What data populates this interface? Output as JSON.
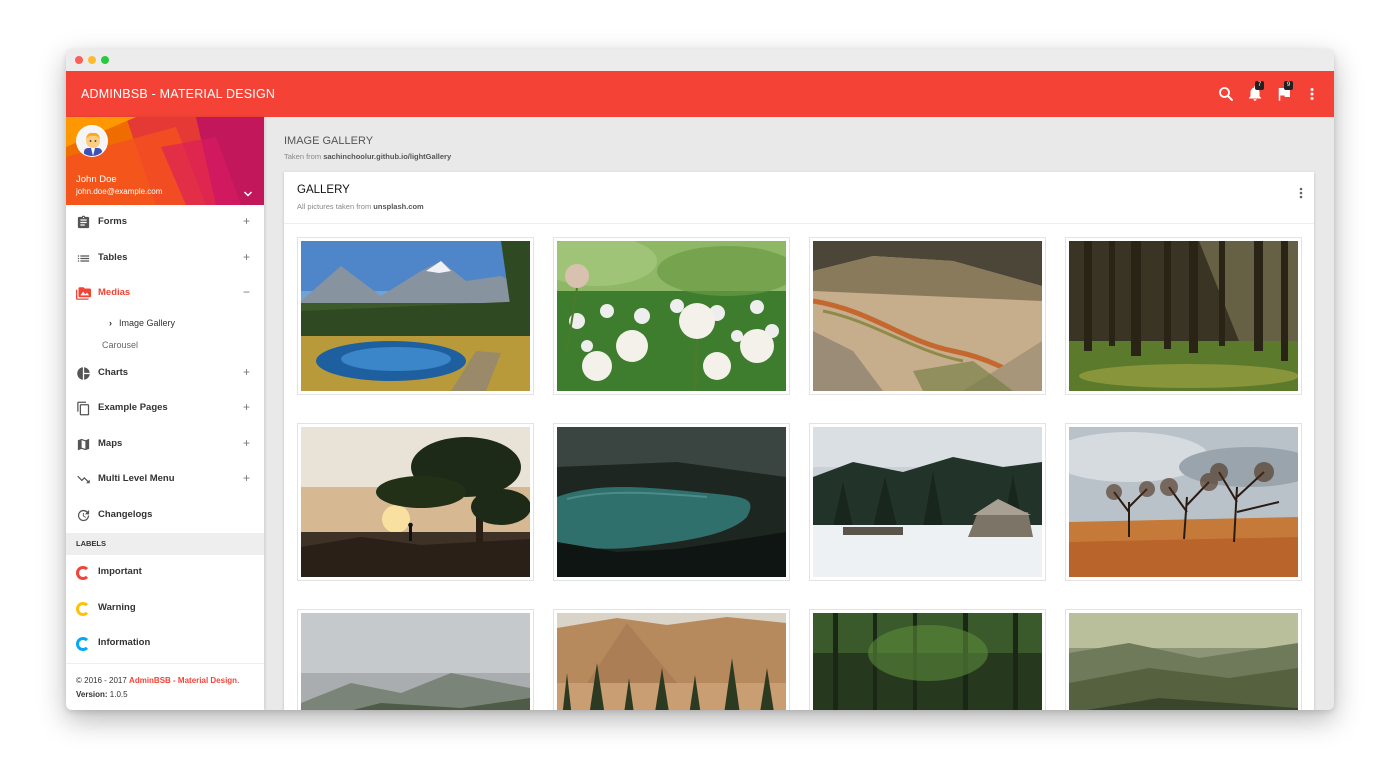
{
  "app": {
    "brand": "ADMINBSB - MATERIAL DESIGN",
    "accent": "#f44336"
  },
  "navbar": {
    "icons": [
      "search-icon",
      "notifications-icon",
      "flag-icon",
      "more-vertical-icon"
    ],
    "notifications_count": "7",
    "tasks_count": "9"
  },
  "user": {
    "name": "John Doe",
    "email": "john.doe@example.com"
  },
  "sidebar": {
    "items": [
      {
        "label": "Forms",
        "icon": "assignment-icon",
        "toggle": "+"
      },
      {
        "label": "Tables",
        "icon": "list-icon",
        "toggle": "+"
      },
      {
        "label": "Medias",
        "icon": "perm-media-icon",
        "toggle": "−"
      },
      {
        "label": "Charts",
        "icon": "pie-chart-icon",
        "toggle": "+"
      },
      {
        "label": "Example Pages",
        "icon": "content-copy-icon",
        "toggle": "+"
      },
      {
        "label": "Maps",
        "icon": "map-icon",
        "toggle": "+"
      },
      {
        "label": "Multi Level Menu",
        "icon": "trending-down-icon",
        "toggle": "+"
      },
      {
        "label": "Changelogs",
        "icon": "update-icon",
        "toggle": ""
      }
    ],
    "submenu": [
      {
        "label": "Image Gallery"
      },
      {
        "label": "Carousel"
      }
    ],
    "labels_header": "LABELS",
    "labels": [
      {
        "label": "Important",
        "color": "#f44336"
      },
      {
        "label": "Warning",
        "color": "#ffc107"
      },
      {
        "label": "Information",
        "color": "#03a9f4"
      }
    ]
  },
  "legal": {
    "copyright_prefix": "© 2016 - 2017 ",
    "copyright_brand": "AdminBSB - Material Design",
    "copyright_suffix": ".",
    "version_label": "Version:",
    "version_value": " 1.0.5"
  },
  "page": {
    "title": "IMAGE GALLERY",
    "subtitle_prefix": "Taken from ",
    "subtitle_source": "sachinchoolur.github.io/lightGallery"
  },
  "card": {
    "title": "GALLERY",
    "subtitle_prefix": "All pictures taken from ",
    "subtitle_source": "unsplash.com"
  },
  "gallery": [
    {
      "name": "mountain-lake-image"
    },
    {
      "name": "clover-flowers-image"
    },
    {
      "name": "riverbed-aerial-image"
    },
    {
      "name": "forest-sunlight-image"
    },
    {
      "name": "sunset-tree-image"
    },
    {
      "name": "dark-lake-image"
    },
    {
      "name": "snow-cabin-image"
    },
    {
      "name": "autumn-trees-image"
    },
    {
      "name": "foggy-hills-image"
    },
    {
      "name": "cliff-forest-image"
    },
    {
      "name": "forest-bridge-image"
    },
    {
      "name": "misty-valley-image"
    }
  ]
}
